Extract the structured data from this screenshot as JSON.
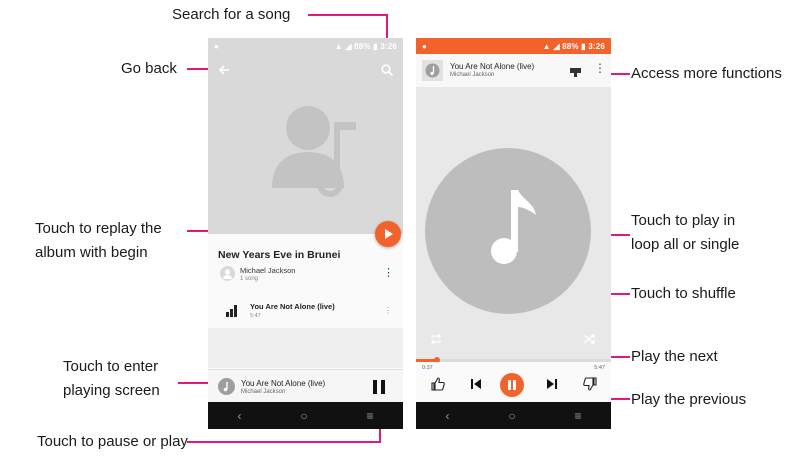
{
  "colors": {
    "accent": "#f2632b",
    "status_bar_phone1": "#d9d9d9",
    "status_bar_phone2": "#f2632b",
    "callout_line": "#e0197d"
  },
  "callouts": {
    "search": "Search for a song",
    "go_back": "Go back",
    "more_functions": "Access more functions",
    "replay_line1": "Touch to replay the",
    "replay_line2": "album with begin",
    "loop_line1": "Touch to play in",
    "loop_line2": "loop all or single",
    "shuffle": "Touch to shuffle",
    "enter_line1": "Touch to enter",
    "enter_line2": "playing screen",
    "play_next": "Play the next",
    "play_previous": "Play the previous",
    "pause_play": "Touch to pause or play"
  },
  "status_bar": {
    "battery": "88%",
    "time": "3:26"
  },
  "album_screen": {
    "album_title": "New Years Eve in Brunei",
    "artist": "Michael Jackson",
    "song_count": "1 song",
    "song_title": "You Are Not Alone (live)",
    "song_duration": "5:47",
    "mini_player": {
      "title": "You Are Not Alone (live)",
      "artist": "Michael Jackson"
    }
  },
  "player_screen": {
    "title": "You Are Not Alone (live)",
    "artist": "Michael Jackson",
    "elapsed": "0:37",
    "total": "5:47",
    "progress_fraction": 0.107
  },
  "icons": {
    "back": "arrow-left-icon",
    "search": "search-icon",
    "cast": "cast-icon",
    "more": "more-vert-icon",
    "repeat": "repeat-icon",
    "shuffle": "shuffle-icon",
    "thumb_up": "thumb-up-icon",
    "thumb_down": "thumb-down-icon",
    "previous": "skip-previous-icon",
    "next": "skip-next-icon",
    "play_pause": "pause-icon",
    "equalizer": "equalizer-icon"
  }
}
